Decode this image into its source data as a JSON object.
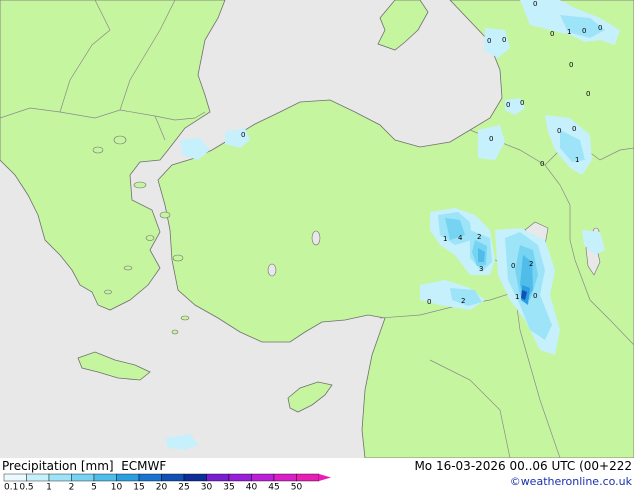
{
  "title": "Precipitation [mm]",
  "model": "ECMWF",
  "datetime": "Mo 16-03-2026 00..06 UTC (00+222",
  "credit": "©weatheronline.co.uk",
  "colors": {
    "sea": "#e8e8e8",
    "land": "#c6f5a0",
    "border": "#8a8a8a",
    "coast": "#6f6f6f"
  },
  "scale": {
    "labels": [
      "0.1",
      "0.5",
      "1",
      "2",
      "5",
      "10",
      "15",
      "20",
      "25",
      "30",
      "35",
      "40",
      "45",
      "50"
    ],
    "colors": [
      "#eafaff",
      "#c6f0fc",
      "#9ee4f8",
      "#76d3f1",
      "#4fbcea",
      "#2a9ee0",
      "#1a74cf",
      "#1250b4",
      "#0c2e96",
      "#7a1fd0",
      "#9a1fd8",
      "#bb1fd8",
      "#d81fc8",
      "#e81fb4"
    ]
  },
  "values": [
    "0",
    "0",
    "1",
    "0",
    "0",
    "0",
    "0",
    "0",
    "0",
    "0",
    "0",
    "0",
    "1",
    "0",
    "0",
    "0",
    "1",
    "4",
    "2",
    "3",
    "0",
    "2",
    "0",
    "2",
    "1",
    "0",
    "0"
  ]
}
